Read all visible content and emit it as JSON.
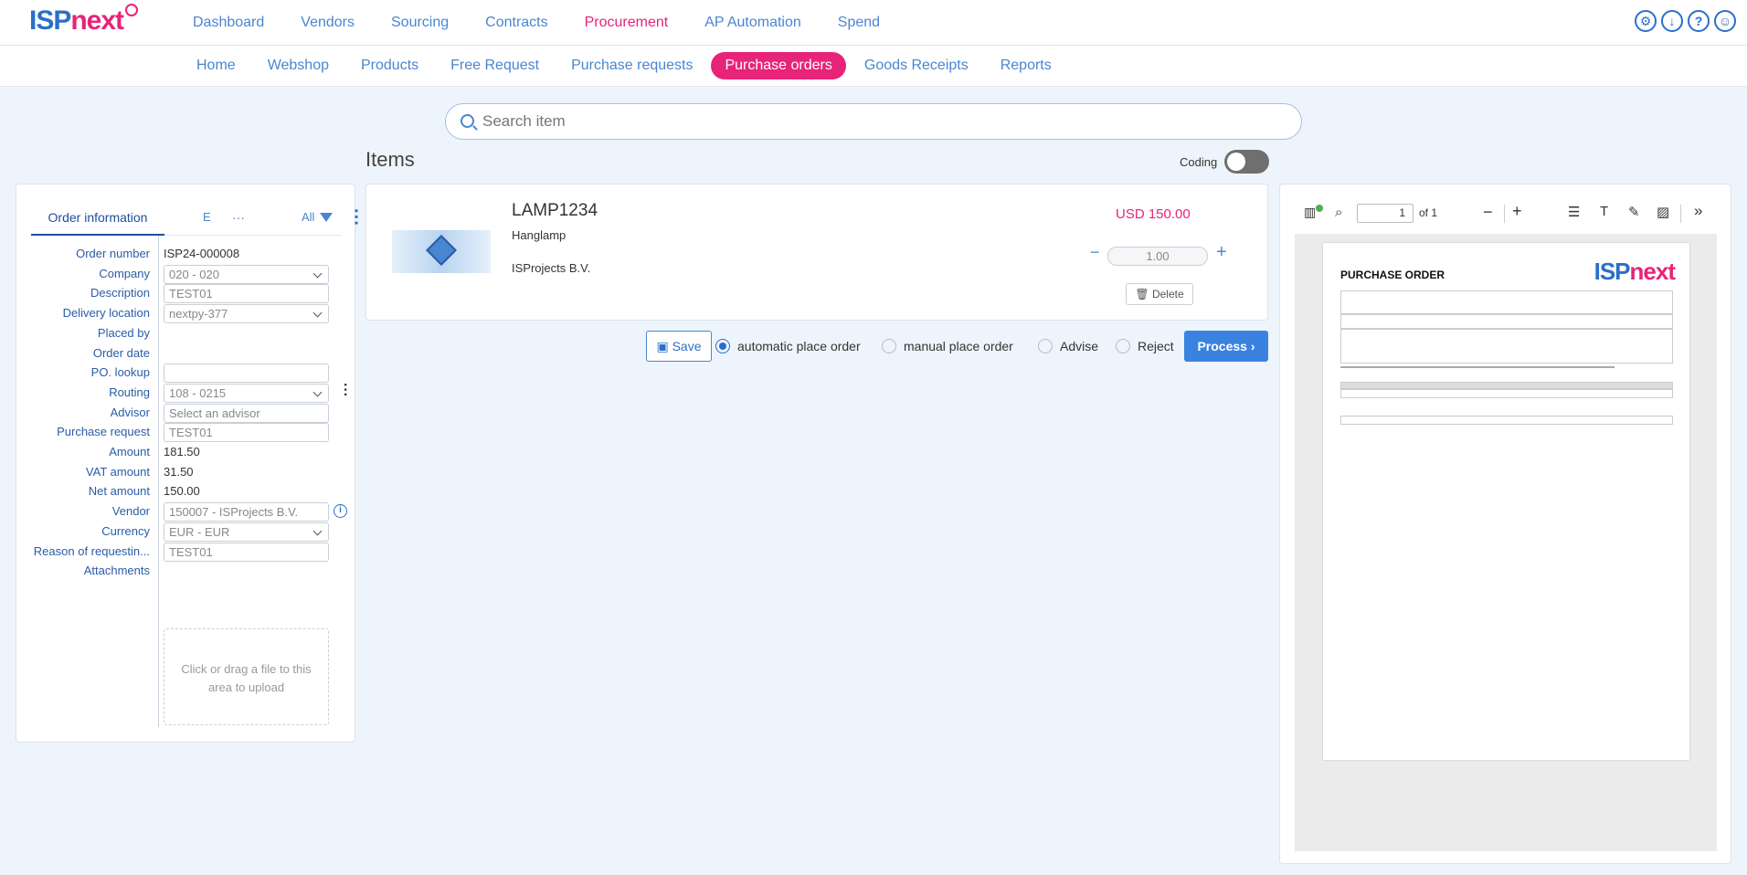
{
  "brand": {
    "logo_isp": "ISP",
    "logo_next": "next"
  },
  "main_nav": [
    "Dashboard",
    "Vendors",
    "Sourcing",
    "Contracts",
    "Procurement",
    "AP Automation",
    "Spend"
  ],
  "main_nav_active": "Procurement",
  "sub_nav": [
    "Home",
    "Webshop",
    "Products",
    "Free Request",
    "Purchase requests",
    "Purchase orders",
    "Goods Receipts",
    "Reports"
  ],
  "sub_nav_active": "Purchase orders",
  "top_icons": [
    "gear-icon",
    "download-icon",
    "help-icon",
    "user-icon"
  ],
  "search": {
    "placeholder": "Search item"
  },
  "items_title": "Items",
  "coding_label": "Coding",
  "left_panel": {
    "tab_active": "Order information",
    "tab_second": "E",
    "tab_more": "···",
    "filter_label": "All",
    "fields": [
      {
        "label": "Order number",
        "value": "ISP24-000008",
        "type": "text"
      },
      {
        "label": "Company",
        "value": "020 - 020",
        "type": "select"
      },
      {
        "label": "Description",
        "value": "TEST01",
        "type": "input"
      },
      {
        "label": "Delivery location",
        "value": "nextpy-377",
        "type": "select"
      },
      {
        "label": "Placed by",
        "value": "",
        "type": "text"
      },
      {
        "label": "Order date",
        "value": "",
        "type": "text"
      },
      {
        "label": "PO. lookup",
        "value": "",
        "type": "input"
      },
      {
        "label": "Routing",
        "value": "108 - 0215",
        "type": "select"
      },
      {
        "label": "Advisor",
        "value": "Select an advisor",
        "type": "input"
      },
      {
        "label": "Purchase request",
        "value": "TEST01",
        "type": "input"
      },
      {
        "label": "Amount",
        "value": "181.50",
        "type": "text"
      },
      {
        "label": "VAT amount",
        "value": "31.50",
        "type": "text"
      },
      {
        "label": "Net amount",
        "value": "150.00",
        "type": "text"
      },
      {
        "label": "Vendor",
        "value": "150007 - ISProjects B.V.",
        "type": "input"
      },
      {
        "label": "Currency",
        "value": "EUR - EUR",
        "type": "select"
      },
      {
        "label": "Reason of requestin...",
        "value": "TEST01",
        "type": "input"
      },
      {
        "label": "Attachments",
        "value": "",
        "type": "text"
      }
    ],
    "upload_text": "Click or drag a file to this area to upload"
  },
  "item": {
    "code": "LAMP1234",
    "description": "Hanglamp",
    "vendor": "ISProjects B.V.",
    "price": "USD 150.00",
    "quantity": "1.00",
    "delete_label": "Delete"
  },
  "actions": {
    "save_label": "Save",
    "options": [
      "automatic place order",
      "manual place order",
      "Advise",
      "Reject"
    ],
    "selected_option": "automatic place order",
    "process_label": "Process"
  },
  "pdf": {
    "page_current": "1",
    "page_total": "of 1",
    "title": "PURCHASE ORDER",
    "logo_isp": "ISP",
    "logo_next": "next"
  }
}
